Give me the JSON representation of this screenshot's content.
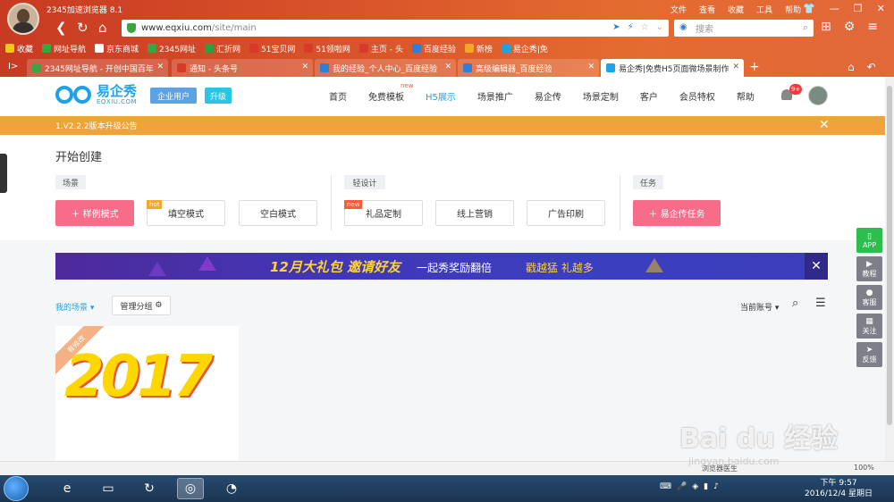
{
  "browser": {
    "app_name": "2345加速浏览器 8.1",
    "menu": [
      "文件",
      "查看",
      "收藏",
      "工具",
      "帮助"
    ],
    "url_host": "www.eqxiu.com",
    "url_path": "/site/main",
    "search_placeholder": "搜索",
    "bookmarks": [
      {
        "label": "收藏",
        "color": "#f5c518"
      },
      {
        "label": "网址导航",
        "color": "#3aa643"
      },
      {
        "label": "京东商城",
        "color": "#ffffff"
      },
      {
        "label": "2345网址",
        "color": "#3aa643"
      },
      {
        "label": "汇折网",
        "color": "#2e9e3e"
      },
      {
        "label": "51宝贝网",
        "color": "#d83a2a"
      },
      {
        "label": "51领啦网",
        "color": "#d83a2a"
      },
      {
        "label": "主页 - 头",
        "color": "#d83a2a"
      },
      {
        "label": "百度经验",
        "color": "#2f7fd8"
      },
      {
        "label": "新榜",
        "color": "#f5a623"
      },
      {
        "label": "易企秀|免",
        "color": "#1da2e8"
      }
    ],
    "tabs": [
      {
        "label": "2345网址导航 - 开创中国百年",
        "color": "#3aa643"
      },
      {
        "label": "通知 - 头条号",
        "color": "#d83a2a"
      },
      {
        "label": "我的经验_个人中心_百度经验",
        "color": "#2f7fd8"
      },
      {
        "label": "高级编辑器_百度经验",
        "color": "#2f7fd8"
      },
      {
        "label": "易企秀|免费H5页面微场景制作",
        "color": "#1da2e8"
      }
    ]
  },
  "site": {
    "logo_name": "易企秀",
    "logo_sub": "EQXIU.COM",
    "enterprise_label": "企业用户",
    "upgrade_label": "升级",
    "nav": [
      {
        "label": "首页",
        "active": false,
        "tag": ""
      },
      {
        "label": "免费模板",
        "active": false,
        "tag": "new"
      },
      {
        "label": "H5展示",
        "active": true,
        "tag": ""
      },
      {
        "label": "场景推广",
        "active": false,
        "tag": ""
      },
      {
        "label": "易企传",
        "active": false,
        "tag": ""
      },
      {
        "label": "场景定制",
        "active": false,
        "tag": ""
      },
      {
        "label": "客户",
        "active": false,
        "tag": ""
      },
      {
        "label": "会员特权",
        "active": false,
        "tag": ""
      },
      {
        "label": "帮助",
        "active": false,
        "tag": ""
      }
    ],
    "notification_badge": "9+",
    "notice": "1.V2.2.2版本升级公告",
    "create_title": "开始创建",
    "groups": {
      "scene": "场景",
      "light": "轻设计",
      "task": "任务"
    },
    "buttons": {
      "sample": "样例模式",
      "fill": "填空模式",
      "fill_tag": "hot",
      "blank": "空白模式",
      "gift": "礼品定制",
      "gift_tag": "new",
      "online": "线上营销",
      "print": "广告印刷",
      "task": "易企传任务"
    },
    "banner": {
      "gift": "12月大礼包",
      "invite": "邀请好友",
      "reward": "一起秀奖励翻倍",
      "more": "戳越猛 礼越多"
    },
    "my_scene": "我的场景",
    "manage_group": "管理分组",
    "current_account": "当前账号",
    "card_ribbon": "有修改",
    "card_art": "2017",
    "right_tools": [
      "APP",
      "教程",
      "客服",
      "关注",
      "反馈"
    ]
  },
  "statusbar": {
    "left": "浏览器医生",
    "zoom": "100%"
  },
  "taskbar": {
    "time": "下午 9:57",
    "date": "2016/12/4 星期日"
  },
  "watermark": {
    "logo": "Bai du 经验",
    "url": "jingyan.baidu.com"
  }
}
